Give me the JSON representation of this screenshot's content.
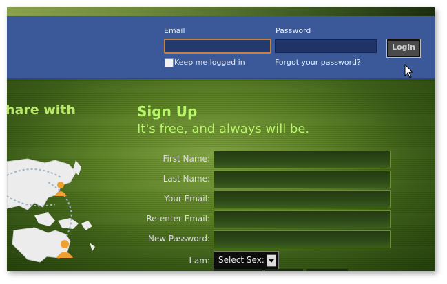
{
  "header": {
    "email_label": "Email",
    "password_label": "Password",
    "login_label": "Login",
    "keep_logged_in": "Keep me logged in",
    "forgot_password": "Forgot your password?"
  },
  "left": {
    "share_text": "hare with"
  },
  "signup": {
    "title": "Sign Up",
    "subtitle": "It's free, and always will be.",
    "fields": [
      {
        "label": "First Name:"
      },
      {
        "label": "Last Name:"
      },
      {
        "label": "Your Email:"
      },
      {
        "label": "Re-enter Email:"
      },
      {
        "label": "New Password:"
      }
    ],
    "iam_label": "I am:",
    "sex_select": "Select Sex:"
  },
  "colors": {
    "header_blue": "#3b5998",
    "signup_green": "#b9f56a",
    "email_focus_border": "#c9803a"
  },
  "icons": [
    "cursor-icon",
    "user-pin-icon",
    "dropdown-arrow-icon"
  ]
}
